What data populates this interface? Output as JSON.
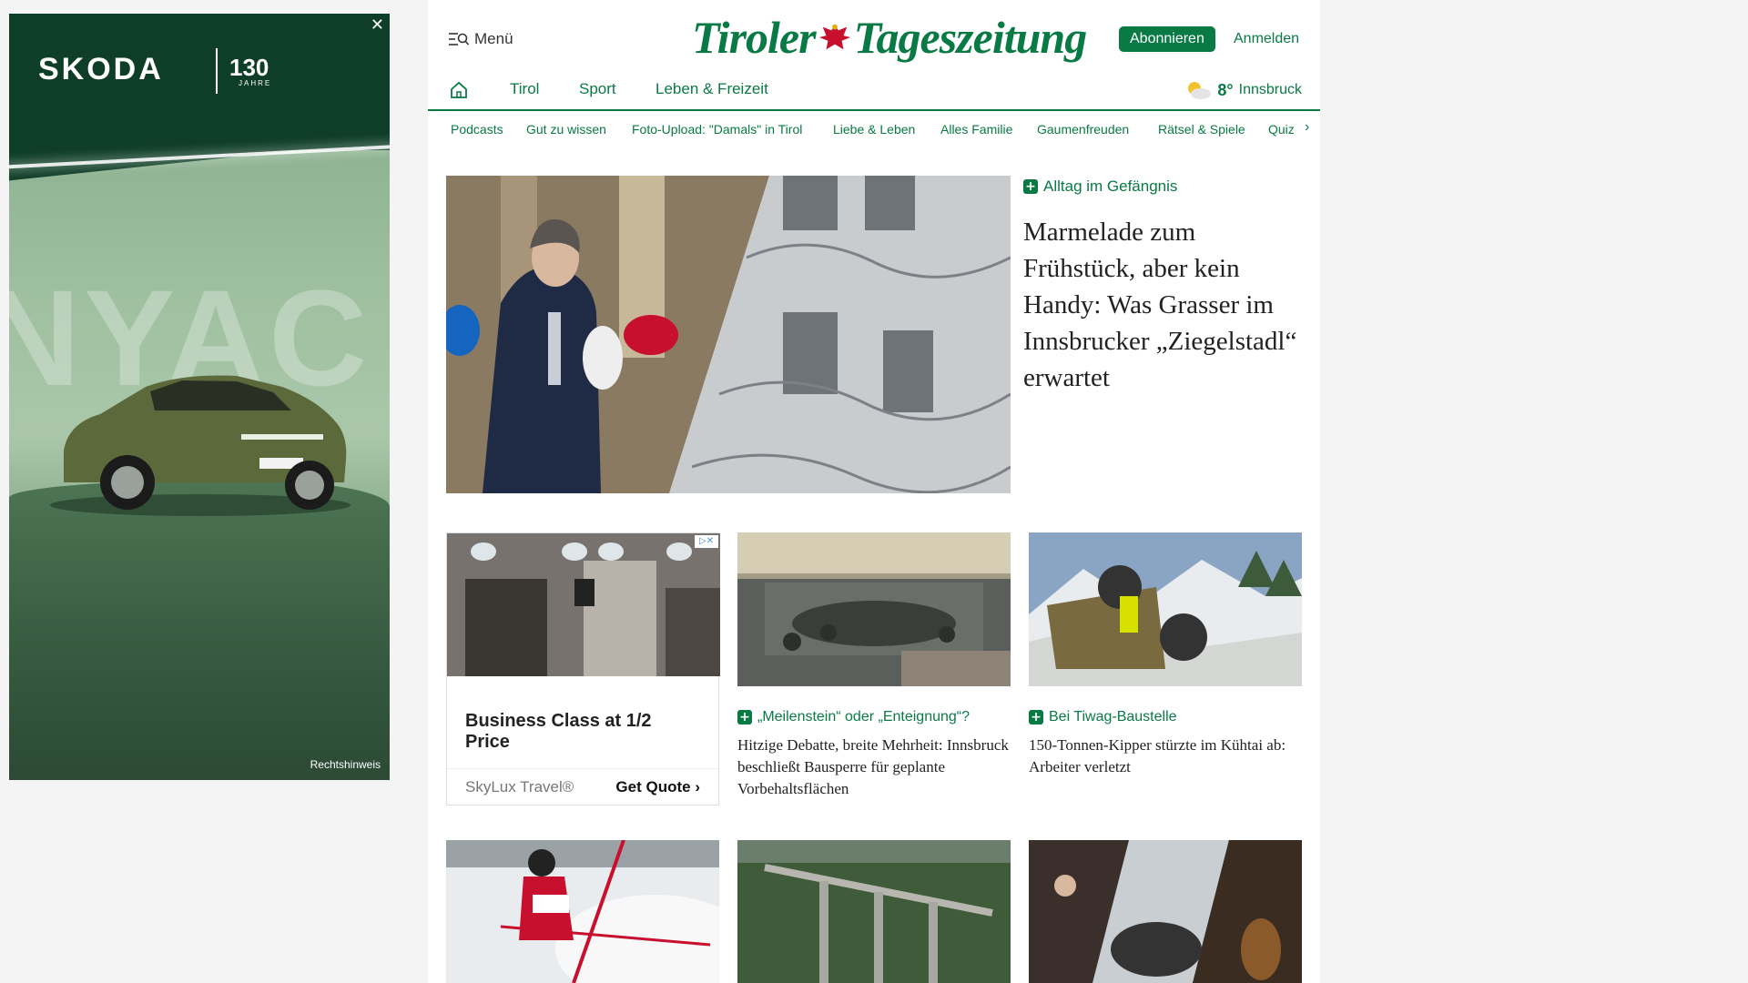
{
  "ad_left": {
    "brand": "SKODA",
    "years": "130",
    "years_sub": "JAHRE",
    "background_word": "NYAC",
    "legal": "Rechtshinweis",
    "close": "✕"
  },
  "header": {
    "menu_label": "Menü",
    "logo_left": "Tiroler",
    "logo_right": "Tageszeitung",
    "subscribe_label": "Abonnieren",
    "login_label": "Anmelden"
  },
  "nav": {
    "items": [
      "Tirol",
      "Sport",
      "Leben & Freizeit"
    ],
    "weather": {
      "temp": "8°",
      "city": "Innsbruck"
    }
  },
  "subnav": [
    "Podcasts",
    "Gut zu wissen",
    "Foto-Upload: \"Damals\" in Tirol",
    "Liebe & Leben",
    "Alles Familie",
    "Gaumenfreuden",
    "Rätsel & Spiele",
    "Quiz"
  ],
  "lead": {
    "kicker": "Alltag im Gefängnis",
    "title": "Marmelade zum Frühstück, aber kein Handy: Was Grasser im Innsbrucker „Ziegelstadl“ erwartet"
  },
  "ad_card": {
    "title": "Business Class at 1/2 Price",
    "advertiser": "SkyLux Travel®",
    "cta": "Get Quote"
  },
  "articles": [
    {
      "kicker": "„Meilenstein“ oder „Enteignung“?",
      "title": "Hitzige Debatte, breite Mehrheit: Innsbruck beschließt Bausperre für geplante Vorbehaltsflächen"
    },
    {
      "kicker": "Bei Tiwag-Baustelle",
      "title": "150-Tonnen-Kipper stürzte im Kühtai ab: Arbeiter verletzt"
    }
  ],
  "colors": {
    "brand_green": "#0a7a45",
    "ad_green": "#0f3e28"
  }
}
